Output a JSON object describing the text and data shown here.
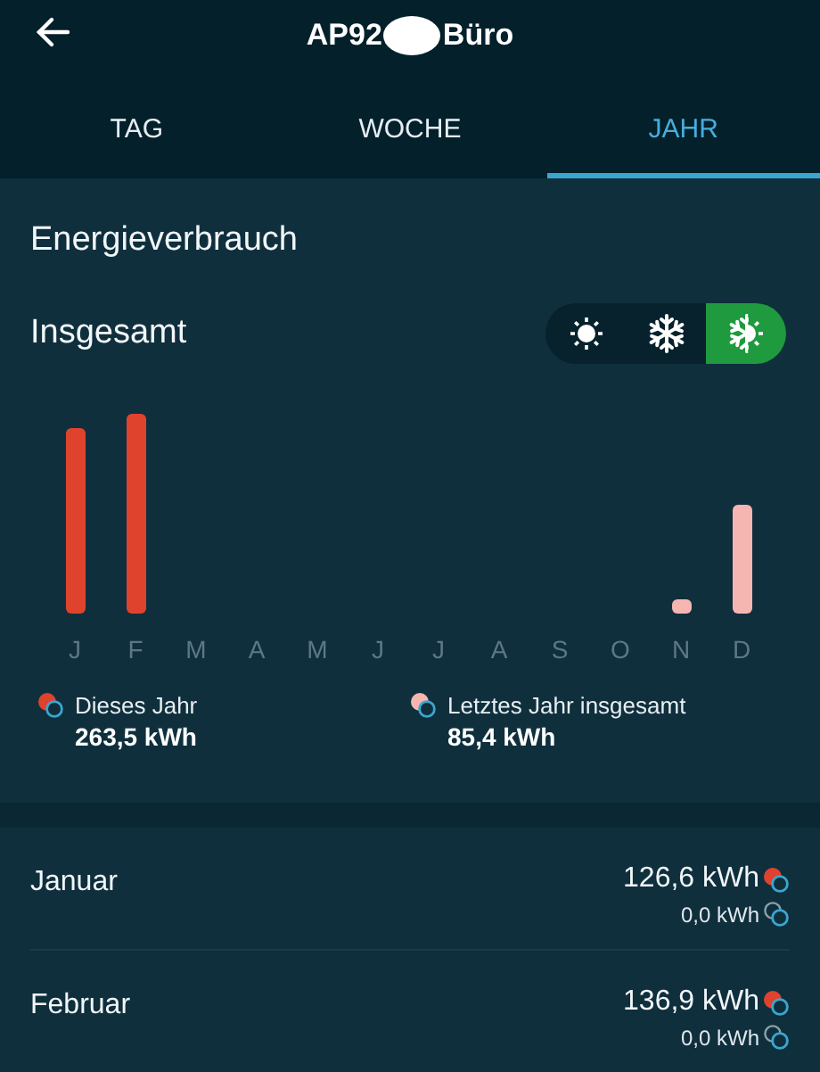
{
  "header": {
    "title_start": "AP92",
    "title_end": "Büro"
  },
  "tabs": [
    {
      "label": "TAG",
      "selected": false
    },
    {
      "label": "WOCHE",
      "selected": false
    },
    {
      "label": "JAHR",
      "selected": true
    }
  ],
  "section_title": "Energieverbrauch",
  "subtitle": "Insgesamt",
  "modes": [
    {
      "kind": "heat",
      "selected": false
    },
    {
      "kind": "cool",
      "selected": false
    },
    {
      "kind": "both",
      "selected": true
    }
  ],
  "months": [
    "J",
    "F",
    "M",
    "A",
    "M",
    "J",
    "J",
    "A",
    "S",
    "O",
    "N",
    "D"
  ],
  "legend": [
    {
      "kind": "current",
      "label": "Dieses Jahr",
      "value": "263,5 kWh"
    },
    {
      "kind": "previous",
      "label": "Letztes Jahr insgesamt",
      "value": "85,4 kWh"
    }
  ],
  "rows": [
    {
      "name": "Januar",
      "heat": "126,6 kWh",
      "cool": "0,0 kWh"
    },
    {
      "name": "Februar",
      "heat": "136,9 kWh",
      "cool": "0,0 kWh"
    }
  ]
}
